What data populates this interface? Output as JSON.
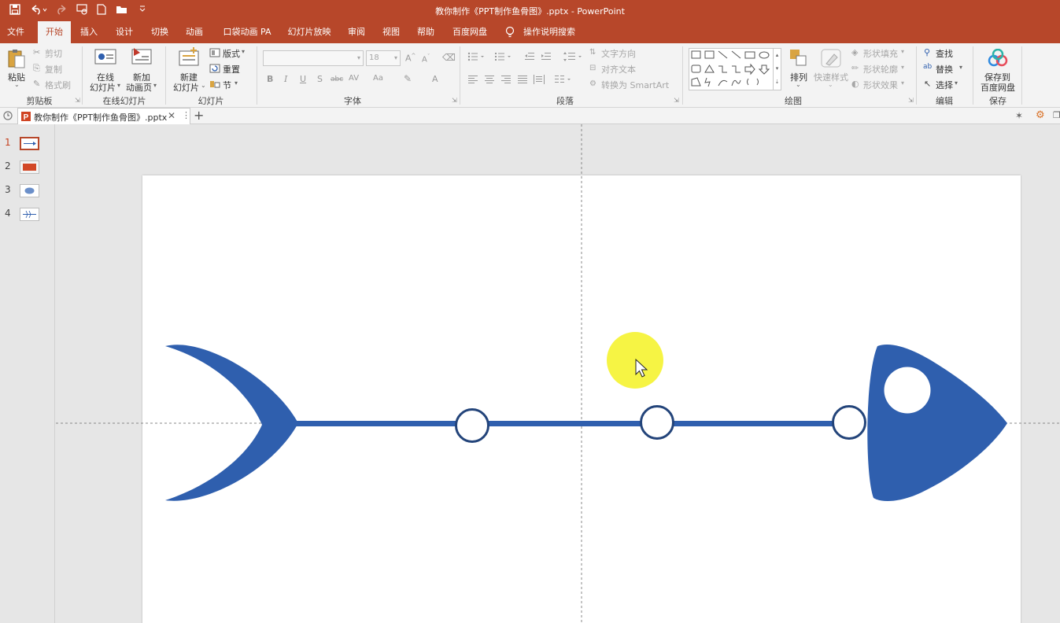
{
  "app": {
    "document_title": "教你制作《PPT制作鱼骨图》.pptx",
    "separator": "-",
    "app_name": "PowerPoint"
  },
  "tabs": [
    "文件",
    "开始",
    "插入",
    "设计",
    "切换",
    "动画",
    "口袋动画 PA",
    "幻灯片放映",
    "审阅",
    "视图",
    "帮助",
    "百度网盘",
    "操作说明搜索"
  ],
  "active_tab": "开始",
  "ribbon": {
    "clipboard": {
      "label": "剪贴板",
      "paste": "粘贴",
      "cut": "剪切",
      "copy": "复制",
      "format_painter": "格式刷"
    },
    "online": {
      "label": "在线幻灯片",
      "online_slides_1": "在线",
      "online_slides_2": "幻灯片",
      "new_anim_1": "新加",
      "new_anim_2": "动画页"
    },
    "slides": {
      "label": "幻灯片",
      "new_slide_1": "新建",
      "new_slide_2": "幻灯片",
      "layout": "版式",
      "reset": "重置",
      "section": "节"
    },
    "font": {
      "label": "字体",
      "size": "18"
    },
    "paragraph": {
      "label": "段落",
      "text_direction": "文字方向",
      "align_text": "对齐文本",
      "convert_smartart": "转换为 SmartArt"
    },
    "drawing": {
      "label": "绘图",
      "arrange": "排列",
      "quick_styles": "快速样式",
      "shape_fill": "形状填充",
      "shape_outline": "形状轮廓",
      "shape_effects": "形状效果"
    },
    "editing": {
      "label": "编辑",
      "find": "查找",
      "replace": "替换",
      "select": "选择"
    },
    "save": {
      "label": "保存",
      "save_to_1": "保存到",
      "save_to_2": "百度网盘"
    }
  },
  "doc_tab": {
    "name": "教你制作《PPT制作鱼骨图》.pptx"
  },
  "thumbnails": [
    "1",
    "2",
    "3",
    "4"
  ],
  "selected_slide": "1",
  "colors": {
    "accent": "#b7472a",
    "fish_blue": "#2f5fae",
    "circle_stroke": "#23447a",
    "highlight": "#f5f22a"
  }
}
